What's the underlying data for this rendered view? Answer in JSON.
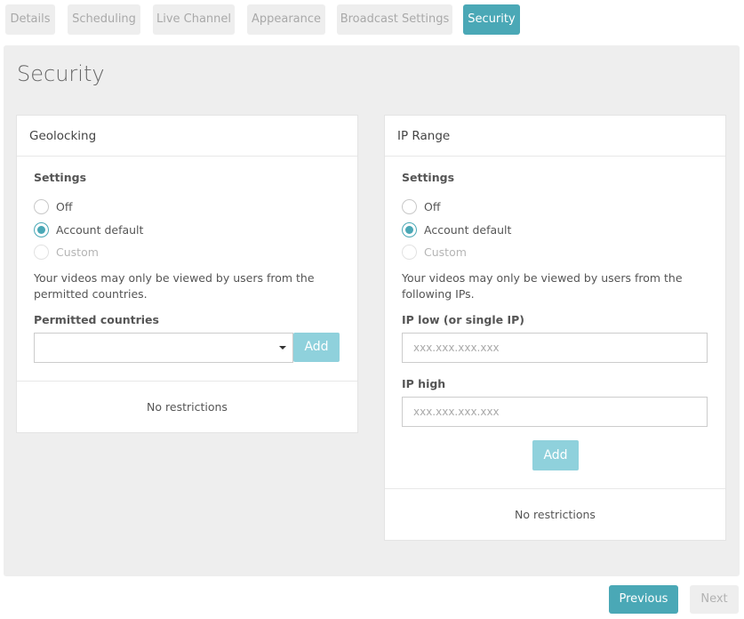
{
  "tabs": [
    {
      "label": "Details",
      "active": false
    },
    {
      "label": "Scheduling",
      "active": false
    },
    {
      "label": "Live Channel",
      "active": false
    },
    {
      "label": "Appearance",
      "active": false
    },
    {
      "label": "Broadcast Settings",
      "active": false
    },
    {
      "label": "Security",
      "active": true
    }
  ],
  "page_title": "Security",
  "geolocking": {
    "title": "Geolocking",
    "settings_label": "Settings",
    "options": [
      {
        "label": "Off",
        "checked": false,
        "disabled": false
      },
      {
        "label": "Account default",
        "checked": true,
        "disabled": false
      },
      {
        "label": "Custom",
        "checked": false,
        "disabled": true
      }
    ],
    "help_text": "Your videos may only be viewed by users from the permitted countries.",
    "countries_label": "Permitted countries",
    "countries_value": "",
    "add_label": "Add",
    "status": "No restrictions"
  },
  "ip_range": {
    "title": "IP Range",
    "settings_label": "Settings",
    "options": [
      {
        "label": "Off",
        "checked": false,
        "disabled": false
      },
      {
        "label": "Account default",
        "checked": true,
        "disabled": false
      },
      {
        "label": "Custom",
        "checked": false,
        "disabled": true
      }
    ],
    "help_text": "Your videos may only be viewed by users from the following IPs.",
    "ip_low_label": "IP low (or single IP)",
    "ip_low_placeholder": "xxx.xxx.xxx.xxx",
    "ip_high_label": "IP high",
    "ip_high_placeholder": "xxx.xxx.xxx.xxx",
    "add_label": "Add",
    "status": "No restrictions"
  },
  "footer": {
    "previous_label": "Previous",
    "next_label": "Next"
  },
  "colors": {
    "accent": "#4aa8b6",
    "accent_light": "#8fd1dc",
    "background": "#eeeeee"
  }
}
